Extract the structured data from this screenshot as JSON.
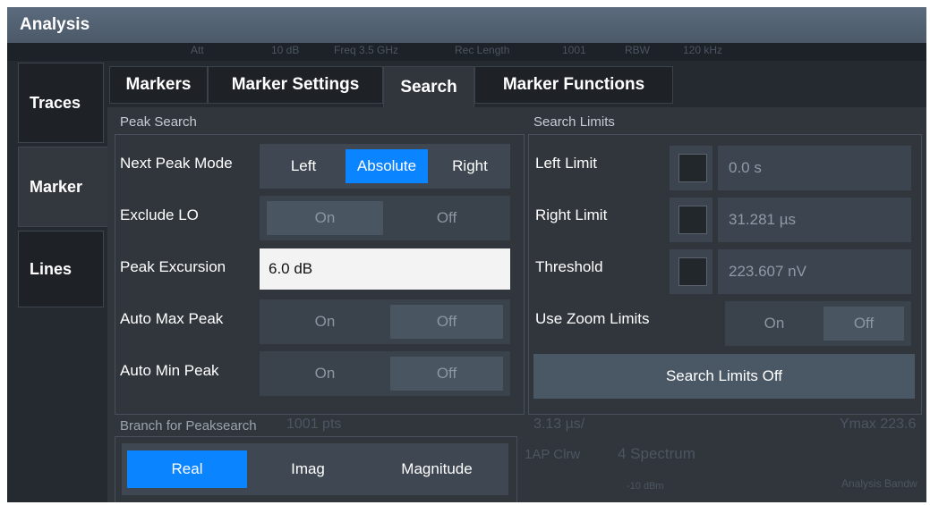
{
  "window": {
    "title": "Analysis"
  },
  "background_text": {
    "top_strip": [
      "Att",
      "10 dB",
      "Freq 3.5 GHz",
      "Rec Length",
      "1001",
      "RBW",
      "120 kHz"
    ],
    "lower_left": "1001 pts",
    "lower_mid": "3.13 µs/",
    "lower_right": "Ymax 223.6",
    "spectrum_label": "4 Spectrum",
    "clrw_label": "1AP Clrw",
    "db_label": "-10 dBm",
    "analysis_bw": "Analysis Bandw"
  },
  "side_tabs": [
    {
      "label": "Traces"
    },
    {
      "label": "Marker"
    },
    {
      "label": "Lines"
    }
  ],
  "tabs": [
    {
      "label": "Markers"
    },
    {
      "label": "Marker Settings"
    },
    {
      "label": "Search"
    },
    {
      "label": "Marker Functions"
    }
  ],
  "peak_search": {
    "title": "Peak Search",
    "next_peak_mode": {
      "label": "Next Peak Mode",
      "options": [
        "Left",
        "Absolute",
        "Right"
      ],
      "selected": "Absolute"
    },
    "exclude_lo": {
      "label": "Exclude LO",
      "on": "On",
      "off": "Off"
    },
    "peak_excursion": {
      "label": "Peak Excursion",
      "value": "6.0 dB"
    },
    "auto_max_peak": {
      "label": "Auto Max Peak",
      "on": "On",
      "off": "Off"
    },
    "auto_min_peak": {
      "label": "Auto Min Peak",
      "on": "On",
      "off": "Off"
    }
  },
  "search_limits": {
    "title": "Search Limits",
    "left_limit": {
      "label": "Left Limit",
      "value": "0.0 s"
    },
    "right_limit": {
      "label": "Right Limit",
      "value": "31.281 µs"
    },
    "threshold": {
      "label": "Threshold",
      "value": "223.607 nV"
    },
    "use_zoom_limits": {
      "label": "Use Zoom Limits",
      "on": "On",
      "off": "Off"
    },
    "limits_off_button": "Search Limits Off"
  },
  "branch": {
    "title": "Branch for Peaksearch",
    "options": [
      "Real",
      "Imag",
      "Magnitude"
    ],
    "selected": "Real"
  },
  "colors": {
    "accent": "#0a84ff",
    "panel": "#31363d",
    "title_bar": "#56657a"
  }
}
